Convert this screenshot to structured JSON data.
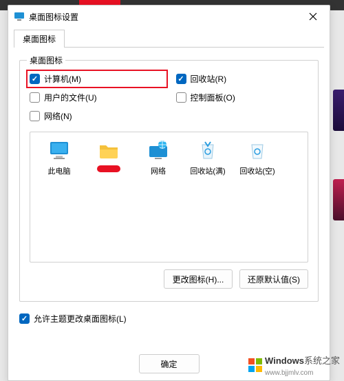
{
  "dialog": {
    "title": "桌面图标设置",
    "tab_label": "桌面图标",
    "fieldset_legend": "桌面图标",
    "checkboxes": {
      "computer": {
        "label": "计算机(M)",
        "checked": true,
        "highlighted": true
      },
      "recycle": {
        "label": "回收站(R)",
        "checked": true
      },
      "userdocs": {
        "label": "用户的文件(U)",
        "checked": false
      },
      "control": {
        "label": "控制面板(O)",
        "checked": false
      },
      "network": {
        "label": "网络(N)",
        "checked": false
      }
    },
    "icons": [
      {
        "id": "this-pc",
        "label": "此电脑",
        "kind": "monitor"
      },
      {
        "id": "redacted",
        "label": "",
        "kind": "folder"
      },
      {
        "id": "network",
        "label": "网络",
        "kind": "globe"
      },
      {
        "id": "bin-full",
        "label": "回收站(满)",
        "kind": "bin"
      },
      {
        "id": "bin-empty",
        "label": "回收站(空)",
        "kind": "bin"
      }
    ],
    "buttons": {
      "change_icon": "更改图标(H)...",
      "restore_default": "还原默认值(S)",
      "ok": "确定"
    },
    "allow_theme": {
      "label": "允许主题更改桌面图标(L)",
      "checked": true
    }
  },
  "watermark": {
    "brand": "Windows",
    "suffix": "系统之家",
    "url": "www.bjjmlv.com"
  }
}
